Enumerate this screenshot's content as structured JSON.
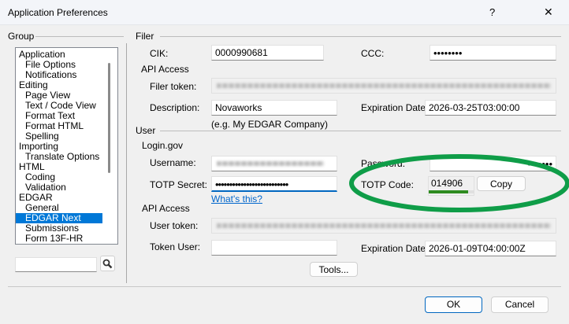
{
  "window": {
    "title": "Application Preferences",
    "help_label": "?",
    "close_label": "✕"
  },
  "group": {
    "label": "Group",
    "items": [
      {
        "label": "Application",
        "level": 0
      },
      {
        "label": "File Options",
        "level": 1
      },
      {
        "label": "Notifications",
        "level": 1
      },
      {
        "label": "Editing",
        "level": 0
      },
      {
        "label": "Page View",
        "level": 1
      },
      {
        "label": "Text / Code View",
        "level": 1
      },
      {
        "label": "Format Text",
        "level": 1
      },
      {
        "label": "Format HTML",
        "level": 1
      },
      {
        "label": "Spelling",
        "level": 1
      },
      {
        "label": "Importing",
        "level": 0
      },
      {
        "label": "Translate Options",
        "level": 1
      },
      {
        "label": "HTML",
        "level": 0
      },
      {
        "label": "Coding",
        "level": 1
      },
      {
        "label": "Validation",
        "level": 1
      },
      {
        "label": "EDGAR",
        "level": 0
      },
      {
        "label": "General",
        "level": 1
      },
      {
        "label": "EDGAR Next",
        "level": 1,
        "selected": true
      },
      {
        "label": "Submissions",
        "level": 1
      },
      {
        "label": "Form 13F-HR",
        "level": 1
      }
    ],
    "search_value": "",
    "search_icon": "magnifier-icon"
  },
  "filer": {
    "section": "Filer",
    "cik_label": "CIK:",
    "cik_value": "0000990681",
    "ccc_label": "CCC:",
    "ccc_value": "••••••••",
    "api_access": "API Access",
    "token_label": "Filer token:",
    "description_label": "Description:",
    "description_value": "Novaworks",
    "description_hint": "(e.g. My EDGAR Company)",
    "expiration_label": "Expiration Date:",
    "expiration_value": "2026-03-25T03:00:00"
  },
  "user": {
    "section": "User",
    "login_gov": "Login.gov",
    "username_label": "Username:",
    "password_label": "Password:",
    "password_value": "•••••••",
    "totp_secret_label": "TOTP Secret:",
    "totp_secret_value": "••••••••••••••••••••••••••",
    "whats_this": "What's this?",
    "totp_code_label": "TOTP Code:",
    "totp_code_value": "014906",
    "totp_progress": 0.88,
    "copy_label": "Copy",
    "api_access": "API Access",
    "token_label": "User token:",
    "token_user_label": "Token User:",
    "token_user_value": "",
    "expiration_label": "Expiration Date:",
    "expiration_value": "2026-01-09T04:00:00Z",
    "tools_label": "Tools..."
  },
  "footer": {
    "ok_label": "OK",
    "cancel_label": "Cancel"
  },
  "colors": {
    "selection": "#0078d7",
    "highlight_oval": "#0f9d48",
    "progress": "#2e8b1f",
    "link": "#0066cc"
  }
}
